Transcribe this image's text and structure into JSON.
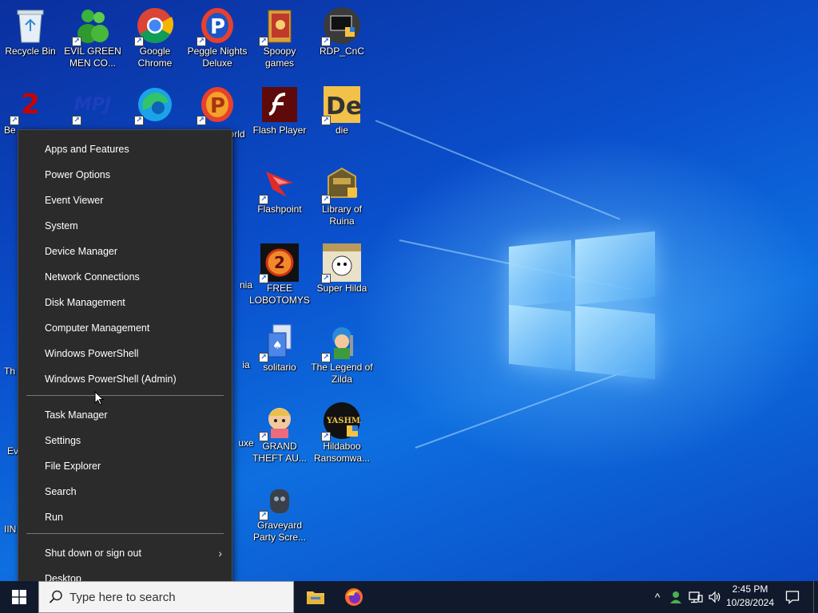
{
  "desktop": {
    "icons": [
      {
        "label": "Recycle Bin",
        "icon": "recycle-bin-icon"
      },
      {
        "label": "EVIL GREEN MEN CO...",
        "icon": "messenger-men-icon"
      },
      {
        "label": "Google Chrome",
        "icon": "chrome-icon"
      },
      {
        "label": "Peggle Nights Deluxe",
        "icon": "peggle-icon"
      },
      {
        "label": "Spoopy games",
        "icon": "folder-icon"
      },
      {
        "label": "RDP_CnC",
        "icon": "rdp-icon"
      },
      {
        "label": "Flash Player",
        "icon": "flash-icon"
      },
      {
        "label": "die",
        "icon": "die-icon"
      },
      {
        "label": "Flashpoint",
        "icon": "flashpoint-icon"
      },
      {
        "label": "Library of Ruina",
        "icon": "library-icon"
      },
      {
        "label": "FREE LOBOTOMYS",
        "icon": "lobotomy-icon"
      },
      {
        "label": "Super Hilda",
        "icon": "super-hilda-icon"
      },
      {
        "label": "solitario",
        "icon": "solitaire-icon"
      },
      {
        "label": "The Legend of Zilda",
        "icon": "zilda-icon"
      },
      {
        "label": "GRAND THEFT AU...",
        "icon": "gta-icon"
      },
      {
        "label": "Hildaboo Ransomwa...",
        "icon": "hildaboo-icon"
      },
      {
        "label": "Graveyard Party Scre...",
        "icon": "graveyard-icon"
      },
      {
        "label": "Be",
        "icon": "partial-icon"
      },
      {
        "label": "World",
        "icon": "partial-icon"
      },
      {
        "label": "nia",
        "icon": "partial-icon"
      },
      {
        "label": "Th",
        "icon": "partial-icon"
      },
      {
        "label": "ia",
        "icon": "partial-icon"
      },
      {
        "label": "Ev",
        "icon": "partial-icon"
      },
      {
        "label": "uxe",
        "icon": "partial-icon"
      },
      {
        "label": "IIN",
        "icon": "partial-icon"
      }
    ]
  },
  "menu": {
    "group1": [
      "Apps and Features",
      "Power Options",
      "Event Viewer",
      "System",
      "Device Manager",
      "Network Connections",
      "Disk Management",
      "Computer Management",
      "Windows PowerShell",
      "Windows PowerShell (Admin)"
    ],
    "group2": [
      "Task Manager",
      "Settings",
      "File Explorer",
      "Search",
      "Run"
    ],
    "shutdown": "Shut down or sign out",
    "desktop": "Desktop"
  },
  "taskbar": {
    "search_placeholder": "Type here to search",
    "pinned": [
      "file-explorer-icon",
      "firefox-icon"
    ],
    "clock_time": "2:45 PM",
    "clock_date": "10/28/2024"
  },
  "colors": {
    "menu_bg": "#2b2b2b",
    "taskbar_bg": "#111a2c",
    "accent": "#0078d7"
  }
}
